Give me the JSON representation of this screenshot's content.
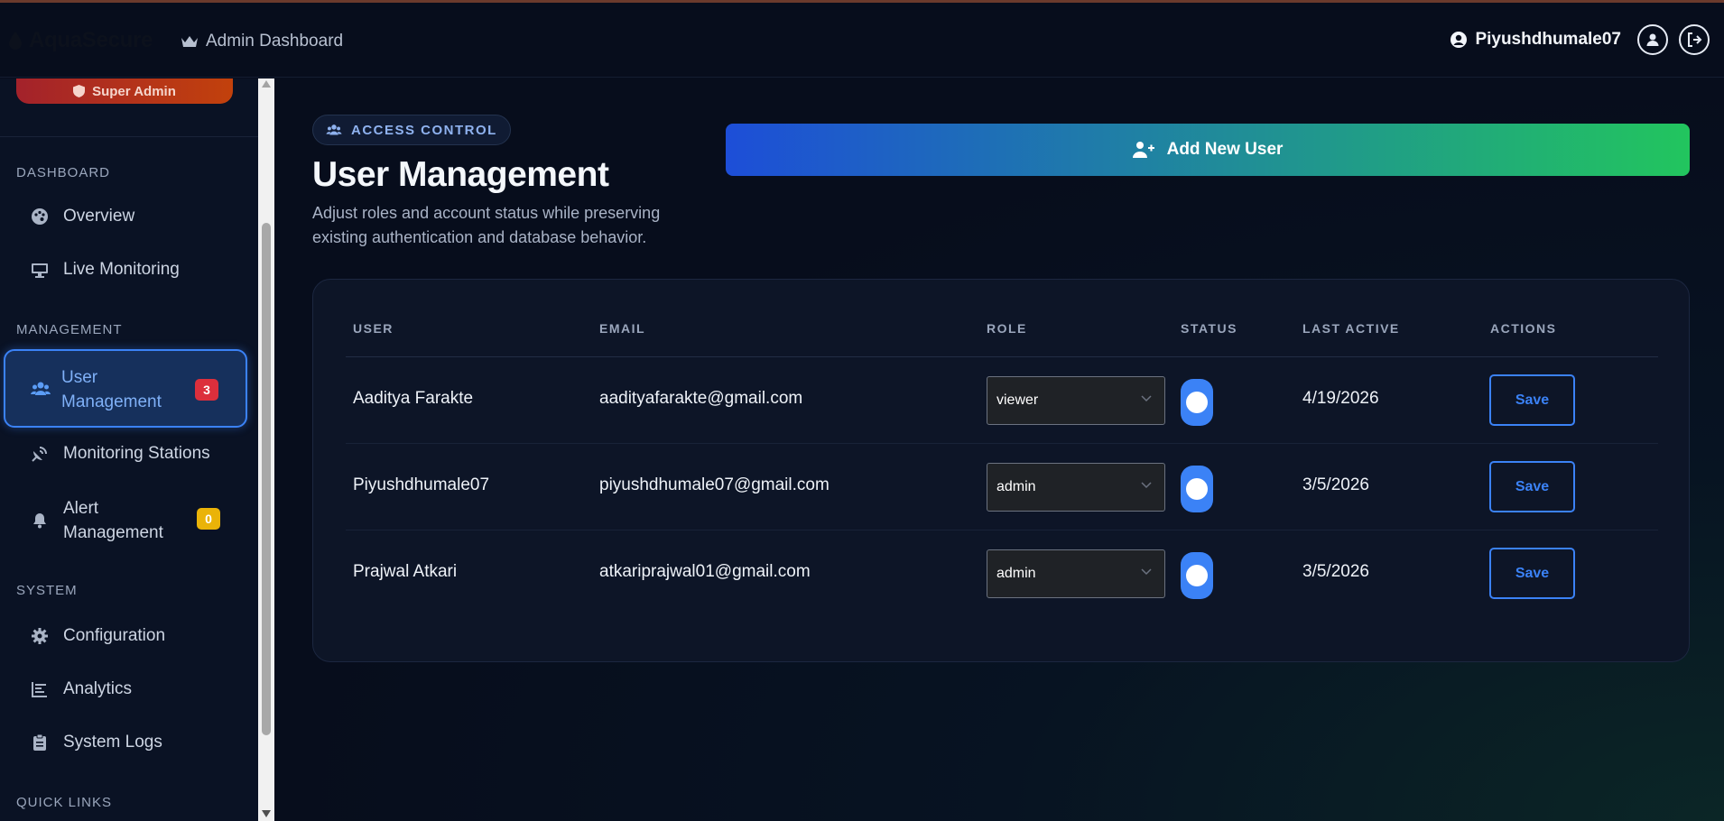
{
  "header": {
    "app_name": "AquaSecure",
    "dashboard_label": "Admin Dashboard",
    "username": "Piyushdhumale07"
  },
  "sidebar": {
    "role_badge": "Super Admin",
    "sections": [
      {
        "title": "DASHBOARD",
        "items": [
          {
            "label": "Overview",
            "icon": "palette-icon"
          },
          {
            "label": "Live Monitoring",
            "icon": "monitor-icon"
          }
        ]
      },
      {
        "title": "MANAGEMENT",
        "items": [
          {
            "label": "User Management",
            "icon": "users-icon",
            "badge": "3",
            "active": true
          },
          {
            "label": "Monitoring Stations",
            "icon": "satellite-dish-icon"
          },
          {
            "label": "Alert Management",
            "icon": "bell-icon",
            "badge": "0"
          }
        ]
      },
      {
        "title": "SYSTEM",
        "items": [
          {
            "label": "Configuration",
            "icon": "gear-icon"
          },
          {
            "label": "Analytics",
            "icon": "chart-icon"
          },
          {
            "label": "System Logs",
            "icon": "clipboard-icon"
          }
        ]
      },
      {
        "title": "QUICK LINKS",
        "items": []
      }
    ]
  },
  "main": {
    "pill_label": "ACCESS CONTROL",
    "title": "User Management",
    "subtitle": "Adjust roles and account status while preserving existing authentication and database behavior.",
    "add_button": "Add New User",
    "table": {
      "headers": [
        "USER",
        "EMAIL",
        "ROLE",
        "STATUS",
        "LAST ACTIVE",
        "ACTIONS"
      ],
      "rows": [
        {
          "user": "Aaditya Farakte",
          "email": "aadityafarakte@gmail.com",
          "role": "viewer",
          "active": true,
          "last_active": "4/19/2026",
          "action": "Save"
        },
        {
          "user": "Piyushdhumale07",
          "email": "piyushdhumale07@gmail.com",
          "role": "admin",
          "active": true,
          "last_active": "3/5/2026",
          "action": "Save"
        },
        {
          "user": "Prajwal Atkari",
          "email": "atkariprajwal01@gmail.com",
          "role": "admin",
          "active": true,
          "last_active": "3/5/2026",
          "action": "Save"
        }
      ]
    }
  },
  "colors": {
    "accent": "#3b82f6",
    "danger": "#dc2f3c",
    "warning": "#eab308",
    "success": "#22c55e"
  }
}
